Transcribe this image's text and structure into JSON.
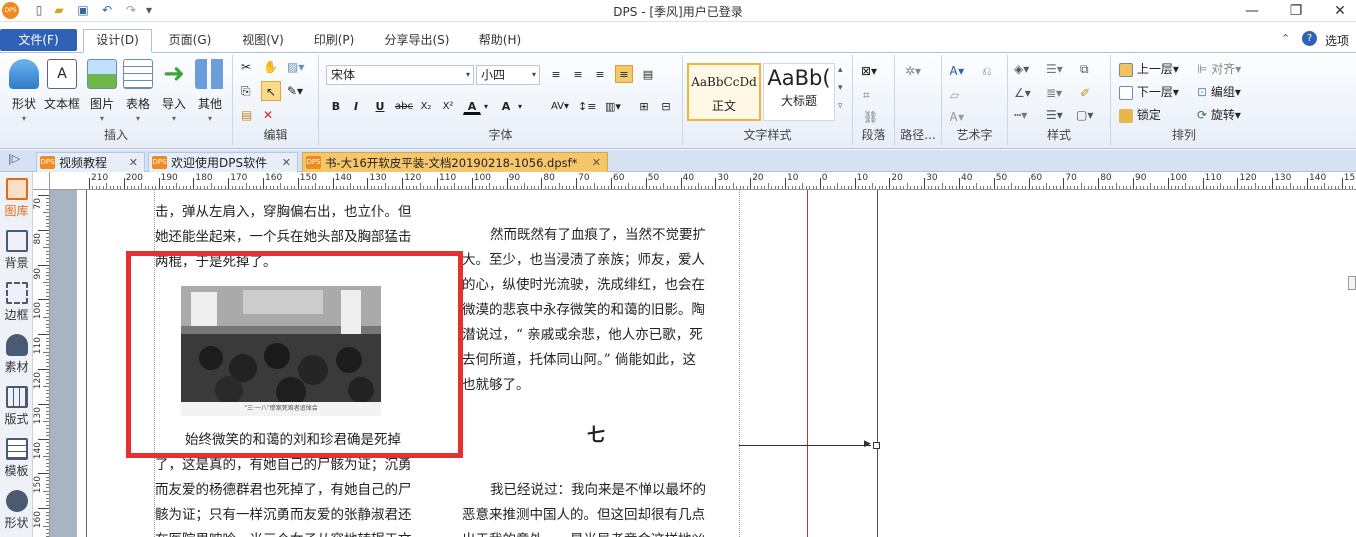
{
  "app": {
    "title": "DPS - [季风]用户已登录",
    "logo_text": "DPS"
  },
  "menu": {
    "tabs": [
      {
        "label": "文件(F)"
      },
      {
        "label": "设计(D)"
      },
      {
        "label": "页面(G)"
      },
      {
        "label": "视图(V)"
      },
      {
        "label": "印刷(P)"
      },
      {
        "label": "分享导出(S)"
      },
      {
        "label": "帮助(H)"
      }
    ],
    "options_label": "选项"
  },
  "ribbon": {
    "insert": {
      "label": "插入",
      "buttons": [
        "形状",
        "文本框",
        "图片",
        "表格",
        "导入",
        "其他"
      ]
    },
    "edit": {
      "label": "编辑"
    },
    "font": {
      "label": "字体",
      "family": "宋体",
      "size": "小四",
      "bold": "B",
      "italic": "I",
      "underline": "U",
      "strike": "abc",
      "sub": "X₂",
      "sup": "X²",
      "color": "A",
      "grow": "A"
    },
    "text_style": {
      "label": "文字样式",
      "styles": [
        {
          "sample": "AaBbCcDd",
          "name": "正文"
        },
        {
          "sample": "AaBb(",
          "name": "大标题"
        }
      ]
    },
    "paragraph": {
      "label": "段落"
    },
    "path": {
      "label": "路径..."
    },
    "art": {
      "label": "艺术字"
    },
    "style": {
      "label": "样式"
    },
    "arrange": {
      "label": "排列",
      "items": [
        "上一层",
        "下一层",
        "锁定",
        "对齐",
        "编组",
        "旋转"
      ]
    }
  },
  "doc_tabs": [
    {
      "label": "视频教程"
    },
    {
      "label": "欢迎使用DPS软件"
    },
    {
      "label": "书-大16开软皮平装-文档20190218-1056.dpsf*"
    }
  ],
  "sidebar": {
    "items": [
      "图库",
      "背景",
      "边框",
      "素材",
      "版式",
      "模板",
      "形状"
    ]
  },
  "rulers": {
    "h_labels": [
      "210",
      "200",
      "190",
      "180",
      "170",
      "160",
      "150",
      "140",
      "130",
      "120",
      "110",
      "100",
      "90",
      "80",
      "70",
      "60",
      "50",
      "40",
      "30",
      "20",
      "10",
      "0",
      "10",
      "20",
      "30",
      "40",
      "50",
      "60",
      "70",
      "80",
      "90",
      "100",
      "110",
      "120",
      "130",
      "140",
      "150"
    ],
    "v_labels": [
      "70",
      "80",
      "90",
      "100",
      "110",
      "120",
      "130",
      "140",
      "150",
      "160"
    ]
  },
  "document": {
    "left_column": [
      "击，弹从左肩入，穿胸偏右出，也立仆。但",
      "她还能坐起来，一个兵在她头部及胸部猛击",
      "两棍，于是死掉了。"
    ],
    "photo_caption": "\"三·一八\"惨案死难者追悼会",
    "left_column_after": [
      "始终微笑的和蔼的刘和珍君确是死掉",
      "了，这是真的，有她自己的尸骸为证；沉勇",
      "而友爱的杨德群君也死掉了，有她自己的尸",
      "骸为证；只有一样沉勇而友爱的张静淑君还",
      "在医院里呻吟。当三个女子从容地转辗于文"
    ],
    "right_column": [
      "然而既然有了血痕了，当然不觉要扩",
      "大。至少，也当浸渍了亲族；师友，爱人",
      "的心，纵使时光流驶，洗成绯红，也会在",
      "微漠的悲哀中永存微笑的和蔼的旧影。陶",
      "潜说过，“ 亲戚或余悲，他人亦已歌，死",
      "去何所道，托体同山阿。” 倘能如此，这",
      "也就够了。"
    ],
    "section_heading": "七",
    "right_column_after": [
      "我已经说过：我向来是不惮以最坏的",
      "恶意来推测中国人的。但这回却很有几点",
      "出于我的意外。一是当局者竟会这样地凶"
    ]
  },
  "colors": {
    "accent": "#2f62b7",
    "highlight_box": "#e53030",
    "active_doc_tab": "#f5c76a",
    "margin_line": "#c0392b"
  }
}
